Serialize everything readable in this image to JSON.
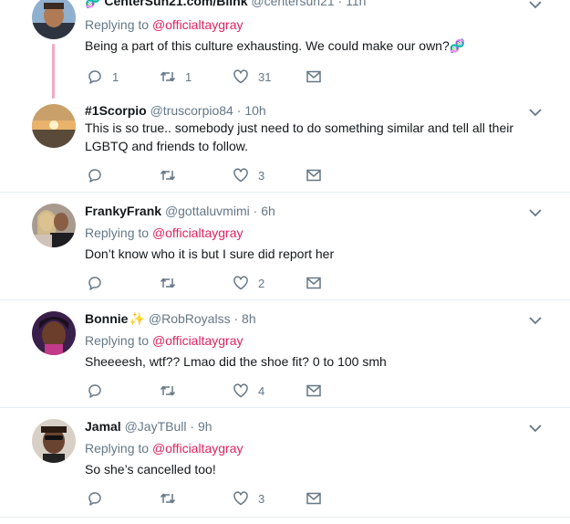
{
  "tweets": [
    {
      "name": "CenterSun21.com/Blink",
      "handle": "@centersun21",
      "dot": " · ",
      "time": "11h",
      "replying_label": "Replying to ",
      "mention": "@officialtaygray",
      "text": "Being a part of this culture exhausting. We could make our own?",
      "text_symbol": "🧬",
      "reply_count": "1",
      "retweet_count": "1",
      "like_count": "31"
    },
    {
      "name": "#1Scorpio",
      "handle": "@truscorpio84",
      "dot": " · ",
      "time": "10h",
      "text": "This is so true.. somebody just need to do something similar and tell all their LGBTQ and friends to follow.",
      "reply_count": "",
      "retweet_count": "",
      "like_count": "3"
    },
    {
      "name": "FrankyFrank",
      "handle": "@gottaluvmimi",
      "dot": " · ",
      "time": "6h",
      "replying_label": "Replying to ",
      "mention": "@officialtaygray",
      "text": "Don’t know who it is but I sure did report her",
      "reply_count": "",
      "retweet_count": "",
      "like_count": "2"
    },
    {
      "name": "Bonnie",
      "name_emoji": "✨",
      "handle": "@RobRoyalss",
      "dot": " · ",
      "time": "8h",
      "replying_label": "Replying to ",
      "mention": "@officialtaygray",
      "text": "Sheeeesh, wtf??  Lmao did the shoe fit? 0 to 100 smh",
      "reply_count": "",
      "retweet_count": "",
      "like_count": "4"
    },
    {
      "name": "Jamal",
      "handle": "@JayTBull",
      "dot": " · ",
      "time": "9h",
      "replying_label": "Replying to ",
      "mention": "@officialtaygray",
      "text": "So she’s cancelled too!",
      "reply_count": "",
      "retweet_count": "",
      "like_count": "3"
    }
  ],
  "icons": {
    "reply": "reply-icon",
    "retweet": "retweet-icon",
    "like": "heart-icon",
    "message": "envelope-icon",
    "caret": "chevron-down-icon"
  },
  "colors": {
    "mention": "#e0245e",
    "secondary_text": "#657786",
    "icon": "#657786",
    "thread_line": "#f4a9c5",
    "divider": "#e6ecf0"
  }
}
